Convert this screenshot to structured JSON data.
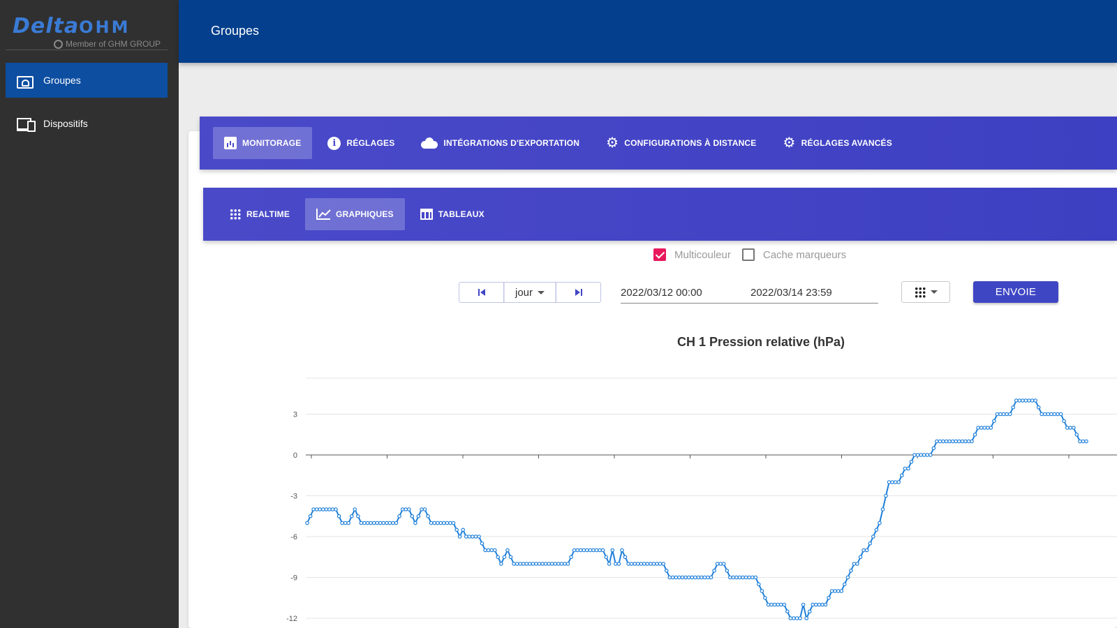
{
  "brand": {
    "logo_main": "Delta",
    "logo_ghm": "OHM",
    "logo_sub": "Member of GHM GROUP"
  },
  "sidebar": {
    "items": [
      {
        "label": "Groupes",
        "icon": "folder-account-icon",
        "active": true
      },
      {
        "label": "Dispositifs",
        "icon": "devices-icon",
        "active": false
      }
    ]
  },
  "header": {
    "title": "Groupes"
  },
  "main_tabs": [
    {
      "label": "MONITORAGE",
      "icon": "bar-chart-icon",
      "active": true
    },
    {
      "label": "RÉGLAGES",
      "icon": "info-icon",
      "active": false
    },
    {
      "label": "INTÉGRATIONS D'EXPORTATION",
      "icon": "cloud-upload-icon",
      "active": false
    },
    {
      "label": "CONFIGURATIONS À DISTANCE",
      "icon": "gear-icon",
      "active": false
    },
    {
      "label": "RÉGLAGES AVANCÉS",
      "icon": "gear-icon",
      "active": false
    }
  ],
  "sub_tabs": [
    {
      "label": "REALTIME",
      "icon": "grid-dots-icon",
      "active": false
    },
    {
      "label": "GRAPHIQUES",
      "icon": "line-chart-icon",
      "active": true
    },
    {
      "label": "TABLEAUX",
      "icon": "table-icon",
      "active": false
    }
  ],
  "options": {
    "multicolor_label": "Multicouleur",
    "multicolor_checked": true,
    "hide_markers_label": "Cache marqueurs",
    "hide_markers_checked": false
  },
  "controls": {
    "period": "jour",
    "date_start": "2022/03/12 00:00",
    "date_end": "2022/03/14 23:59",
    "send_label": "ENVOIE"
  },
  "colors": {
    "primary": "#033f8c",
    "tab_bar": "#4a4ac9",
    "accent": "#e8185c",
    "series": "#1e7fd9"
  },
  "chart_data": {
    "type": "line",
    "title": "CH 1 Pression relative (hPa)",
    "xlabel": "",
    "ylabel": "",
    "ylim": [
      -13,
      5.5
    ],
    "yticks": [
      3,
      0,
      -3,
      -6,
      -9,
      -12
    ],
    "grid": true,
    "legend": "none",
    "series": [
      {
        "values": [
          -5,
          -4.5,
          -4,
          -4,
          -4,
          -4,
          -4,
          -4,
          -4,
          -4,
          -4.5,
          -5,
          -5,
          -5,
          -4.5,
          -4,
          -4.5,
          -5,
          -5,
          -5,
          -5,
          -5,
          -5,
          -5,
          -5,
          -5,
          -5,
          -5,
          -5,
          -4.5,
          -4,
          -4,
          -4,
          -4.5,
          -5,
          -4.5,
          -4,
          -4,
          -4.5,
          -5,
          -5,
          -5,
          -5,
          -5,
          -5,
          -5,
          -5,
          -5.5,
          -6,
          -5.5,
          -6,
          -6,
          -6,
          -6,
          -6,
          -6.5,
          -7,
          -7,
          -7,
          -7,
          -7.5,
          -8,
          -7.5,
          -7,
          -7.5,
          -8,
          -8,
          -8,
          -8,
          -8,
          -8,
          -8,
          -8,
          -8,
          -8,
          -8,
          -8,
          -8,
          -8,
          -8,
          -8,
          -8,
          -8,
          -7.5,
          -7,
          -7,
          -7,
          -7,
          -7,
          -7,
          -7,
          -7,
          -7,
          -7,
          -7.5,
          -8,
          -7,
          -8,
          -8,
          -7,
          -7.5,
          -8,
          -8,
          -8,
          -8,
          -8,
          -8,
          -8,
          -8,
          -8,
          -8,
          -8,
          -8,
          -8.5,
          -9,
          -9,
          -9,
          -9,
          -9,
          -9,
          -9,
          -9,
          -9,
          -9,
          -9,
          -9,
          -9,
          -9,
          -8.5,
          -8,
          -8,
          -8,
          -8.5,
          -9,
          -9,
          -9,
          -9,
          -9,
          -9,
          -9,
          -9,
          -9,
          -9.5,
          -10,
          -10.5,
          -11,
          -11,
          -11,
          -11,
          -11,
          -11,
          -11.5,
          -12,
          -12,
          -12,
          -12,
          -11,
          -12,
          -11.5,
          -11,
          -11,
          -11,
          -11,
          -11,
          -10.5,
          -10,
          -10,
          -10,
          -10,
          -9.5,
          -9,
          -8.5,
          -8,
          -8,
          -7.5,
          -7,
          -7,
          -6.5,
          -6,
          -5.5,
          -5,
          -4,
          -3,
          -2,
          -2,
          -2,
          -2,
          -1.5,
          -1,
          -1,
          -0.5,
          0,
          0,
          0,
          0,
          0,
          0,
          0.5,
          1,
          1,
          1,
          1,
          1,
          1,
          1,
          1,
          1,
          1,
          1,
          1,
          1.5,
          2,
          2,
          2,
          2,
          2,
          2.5,
          3,
          3,
          3,
          3,
          3,
          3.5,
          4,
          4,
          4,
          4,
          4,
          4,
          4,
          3.5,
          3,
          3,
          3,
          3,
          3,
          3,
          3,
          2.5,
          2,
          2,
          2,
          1.5,
          1,
          1,
          1
        ]
      }
    ]
  }
}
